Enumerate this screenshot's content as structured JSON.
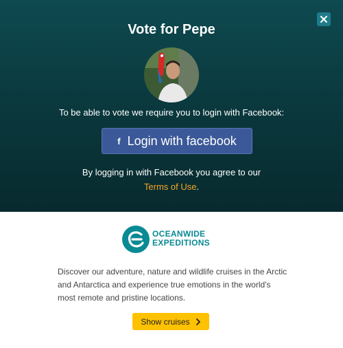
{
  "modal": {
    "title": "Vote for Pepe",
    "login_required_text": "To be able to vote we require you to login with Facebook:",
    "facebook_button_label": "Login with facebook",
    "agree_text": "By logging in with Facebook you agree to our",
    "terms_link": "Terms of Use",
    "terms_suffix": ".",
    "close_icon": "close-icon"
  },
  "sponsor": {
    "logo_line1": "Oceanwide",
    "logo_line2": "Expeditions",
    "description": "Discover our adventure, nature and wildlife cruises in the Arctic and Antarctica and experience true emotions in the world's most remote and pristine locations.",
    "cta_label": "Show cruises"
  },
  "colors": {
    "header_bg": "#0b3d42",
    "facebook": "#3b5998",
    "link": "#f5a623",
    "brand": "#0a8a94",
    "cta": "#ffc200"
  }
}
